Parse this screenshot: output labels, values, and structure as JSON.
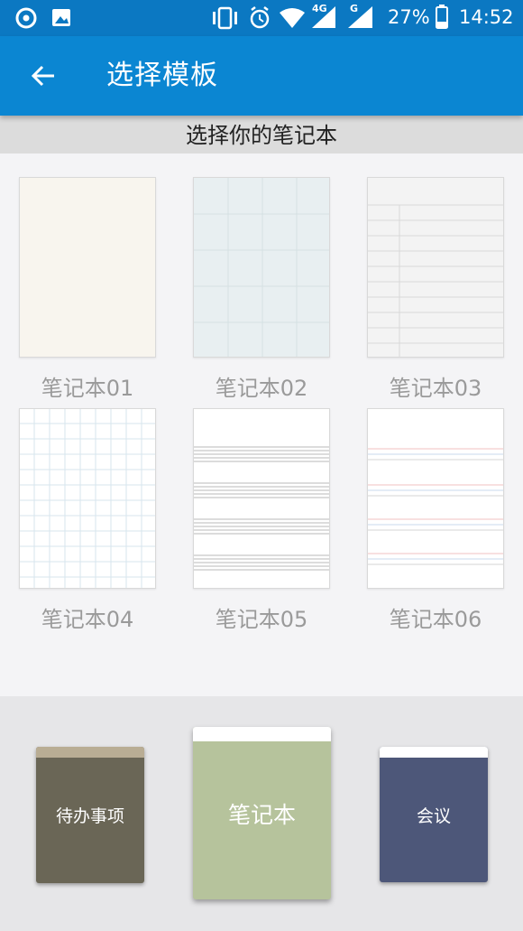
{
  "status_bar": {
    "left_icons": [
      "netease-music-icon",
      "image-icon"
    ],
    "right_icons": [
      "vibrate-icon",
      "alarm-icon",
      "wifi-icon",
      "signal-4g-icon",
      "signal-g-icon"
    ],
    "network_4g": "4G",
    "network_g": "G",
    "battery": "27%",
    "time": "14:52"
  },
  "header": {
    "title": "选择模板",
    "back_icon": "arrow-left-icon"
  },
  "section_title": "选择你的笔记本",
  "templates": [
    {
      "label": "笔记本01",
      "style": "plain-cream"
    },
    {
      "label": "笔记本02",
      "style": "grid-light-blue"
    },
    {
      "label": "笔记本03",
      "style": "lined-gray-margin"
    },
    {
      "label": "笔记本04",
      "style": "grid-white"
    },
    {
      "label": "笔记本05",
      "style": "music-staff"
    },
    {
      "label": "笔记本06",
      "style": "colored-lines"
    }
  ],
  "covers": [
    {
      "label": "待办事项",
      "color": "#6a6656",
      "strip_color": "#b9ad94"
    },
    {
      "label": "笔记本",
      "color": "#b6c39c",
      "strip_color": "#ffffff",
      "selected": true
    },
    {
      "label": "会议",
      "color": "#4d5779",
      "strip_color": "#ffffff"
    }
  ]
}
